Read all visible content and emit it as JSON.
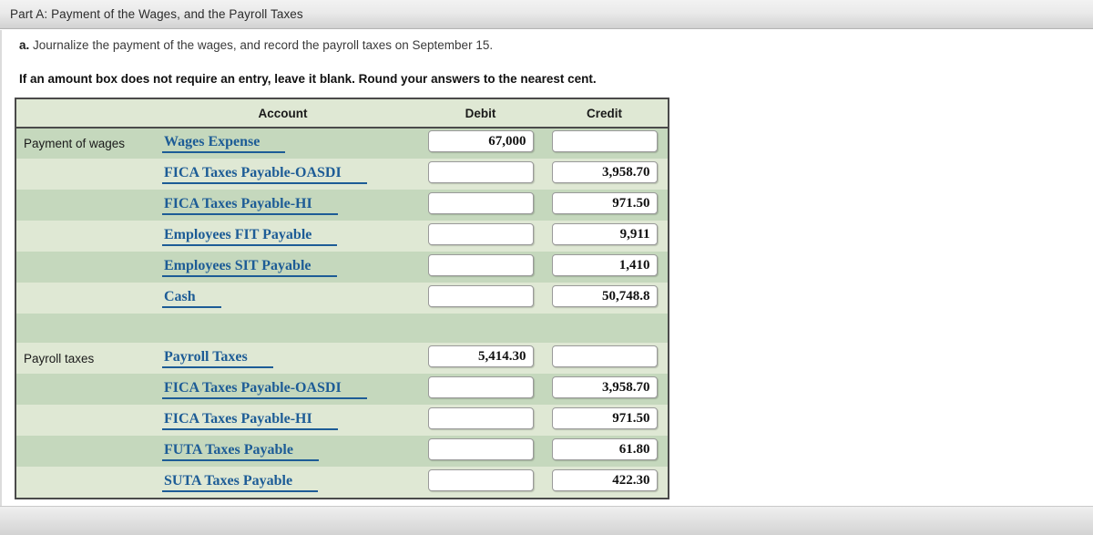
{
  "titlebar": {
    "title": "Part A: Payment of the Wages, and the Payroll Taxes"
  },
  "instructions": {
    "item_letter": "a.",
    "item_text": "Journalize the payment of the wages, and record the payroll taxes on September 15.",
    "note": "If an amount box does not require an entry, leave it blank. Round your answers to the nearest cent."
  },
  "table": {
    "headers": {
      "label": "",
      "account": "Account",
      "debit": "Debit",
      "credit": "Credit"
    },
    "rows": [
      {
        "label": "Payment of wages",
        "account": "Wages Expense",
        "debit": "67,000",
        "credit": "",
        "shade": "dark",
        "spacer": false
      },
      {
        "label": "",
        "account": "FICA Taxes Payable-OASDI",
        "debit": "",
        "credit": "3,958.70",
        "shade": "light",
        "spacer": false
      },
      {
        "label": "",
        "account": "FICA Taxes Payable-HI",
        "debit": "",
        "credit": "971.50",
        "shade": "dark",
        "spacer": false
      },
      {
        "label": "",
        "account": "Employees FIT Payable",
        "debit": "",
        "credit": "9,911",
        "shade": "light",
        "spacer": false
      },
      {
        "label": "",
        "account": "Employees SIT Payable",
        "debit": "",
        "credit": "1,410",
        "shade": "dark",
        "spacer": false
      },
      {
        "label": "",
        "account": "Cash",
        "debit": "",
        "credit": "50,748.8",
        "shade": "light",
        "spacer": false
      },
      {
        "label": "",
        "account": "",
        "debit": "",
        "credit": "",
        "shade": "dark",
        "spacer": true
      },
      {
        "label": "Payroll taxes",
        "account": "Payroll Taxes",
        "debit": "5,414.30",
        "credit": "",
        "shade": "light",
        "spacer": false
      },
      {
        "label": "",
        "account": "FICA Taxes Payable-OASDI",
        "debit": "",
        "credit": "3,958.70",
        "shade": "dark",
        "spacer": false
      },
      {
        "label": "",
        "account": "FICA Taxes Payable-HI",
        "debit": "",
        "credit": "971.50",
        "shade": "light",
        "spacer": false
      },
      {
        "label": "",
        "account": "FUTA Taxes Payable",
        "debit": "",
        "credit": "61.80",
        "shade": "dark",
        "spacer": false
      },
      {
        "label": "",
        "account": "SUTA Taxes Payable",
        "debit": "",
        "credit": "422.30",
        "shade": "light",
        "spacer": false
      }
    ]
  },
  "colors": {
    "row_dark": "#c5d8bd",
    "row_light": "#dfe8d4",
    "link_blue": "#1d5c96",
    "table_border": "#4a4a4a",
    "titlebar_bg": "#e6e6e6"
  }
}
